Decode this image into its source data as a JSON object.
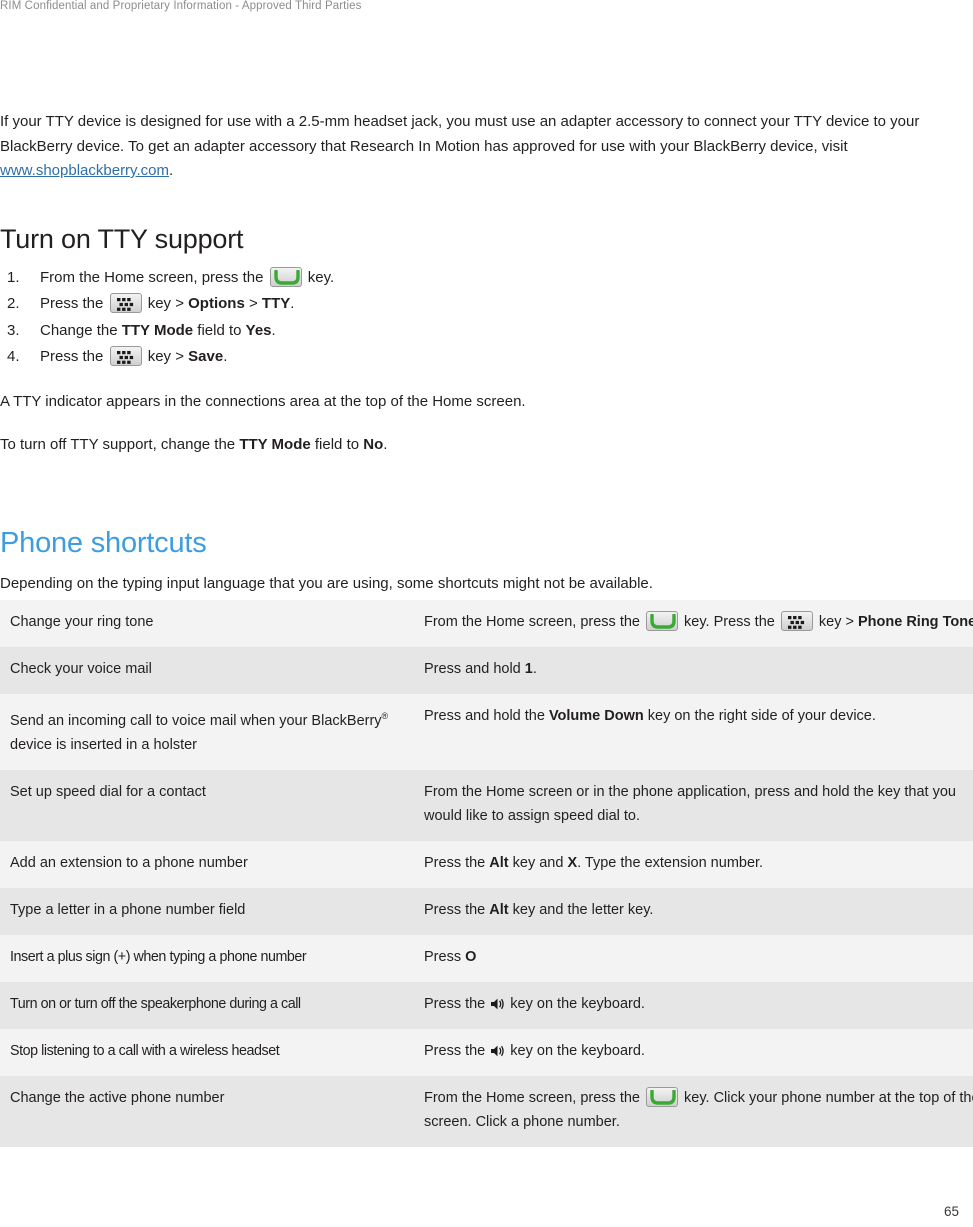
{
  "header": {
    "confidentiality_notice": "RIM Confidential and Proprietary Information - Approved Third Parties"
  },
  "footer": {
    "page_number": "65"
  },
  "colors": {
    "link": "#2f6fa8",
    "heading_blue": "#3c9ee0",
    "body_text": "#231f20",
    "row_light": "#f3f3f3",
    "row_dark": "#e6e6e6",
    "call_key_green": "#3aaa35"
  },
  "intro": {
    "paragraph_part1": "If your TTY device is designed for use with a 2.5-mm headset jack, you must use an adapter accessory to connect your TTY device to your BlackBerry device. To get an adapter accessory that Research In Motion has approved for use with your BlackBerry device, visit ",
    "link_text": "www.shopblackberry.com",
    "paragraph_part2": "."
  },
  "tty_section": {
    "title": "Turn on TTY support",
    "steps": [
      {
        "number": "1.",
        "before_icon": "From the Home screen, press the ",
        "icon": "call-key-icon",
        "after_icon": " key."
      },
      {
        "number": "2.",
        "before_icon": "Press the ",
        "icon": "menu-key-icon",
        "after_icon": " key > ",
        "bold1": "Options",
        "mid": " > ",
        "bold2": "TTY",
        "tail": "."
      },
      {
        "number": "3.",
        "before_icon": "Change the ",
        "bold1": "TTY Mode",
        "mid": " field to ",
        "bold2": "Yes",
        "tail": "."
      },
      {
        "number": "4.",
        "before_icon": "Press the ",
        "icon": "menu-key-icon",
        "after_icon": " key > ",
        "bold1": "Save",
        "tail": "."
      }
    ],
    "note_indicator": "A TTY indicator appears in the connections area at the top of the Home screen.",
    "note_turnoff_part1": "To turn off TTY support, change the ",
    "note_turnoff_bold1": "TTY Mode",
    "note_turnoff_part2": " field to ",
    "note_turnoff_bold2": "No",
    "note_turnoff_part3": "."
  },
  "phone_shortcuts": {
    "title": "Phone shortcuts",
    "intro": "Depending on the typing input language that you are using, some shortcuts might not be available.",
    "rows": [
      {
        "task": "Change your ring tone",
        "action_s1": "From the Home screen, press the ",
        "icon1": "call-key-icon",
        "action_s2": " key. Press the ",
        "icon2": "menu-key-icon",
        "action_s3": " key > ",
        "action_bold": "Phone Ring Tones",
        "action_s4": "."
      },
      {
        "task": "Check your voice mail",
        "action_s1": "Press and hold ",
        "action_bold": "1",
        "action_s4": "."
      },
      {
        "task_part1": "Send an incoming call to voice mail when your BlackBerry",
        "task_sup": "®",
        "task_part2": " device is inserted in a holster",
        "action_s1": "Press and hold the ",
        "action_bold": "Volume Down",
        "action_s4": " key on the right side of your device."
      },
      {
        "task": "Set up speed dial for a contact",
        "action_s1": "From the Home screen or in the phone application, press and hold the key that you would like to assign speed dial to."
      },
      {
        "task": "Add an extension to a phone number",
        "action_s1": "Press the ",
        "action_bold": "Alt",
        "action_s2": " key and ",
        "action_bold2": "X",
        "action_s4": ". Type the extension number."
      },
      {
        "task": "Type a letter in a phone number field",
        "action_s1": "Press the ",
        "action_bold": "Alt",
        "action_s4": " key and the letter key."
      },
      {
        "task": "Insert a plus sign (+) when typing a phone number",
        "action_s1": "Press ",
        "action_bold": "O"
      },
      {
        "task": "Turn on or turn off the speakerphone during a call",
        "action_s1": "Press the ",
        "icon1": "speaker-icon",
        "action_s2": " key on the keyboard."
      },
      {
        "task": "Stop listening to a call with a wireless headset",
        "action_s1": "Press the ",
        "icon1": "speaker-icon",
        "action_s2": " key on the keyboard."
      },
      {
        "task": "Change the active phone number",
        "action_s1": "From the Home screen, press the ",
        "icon1": "call-key-icon",
        "action_s2": " key. Click your phone number at the top of the screen. Click a phone number."
      }
    ]
  }
}
